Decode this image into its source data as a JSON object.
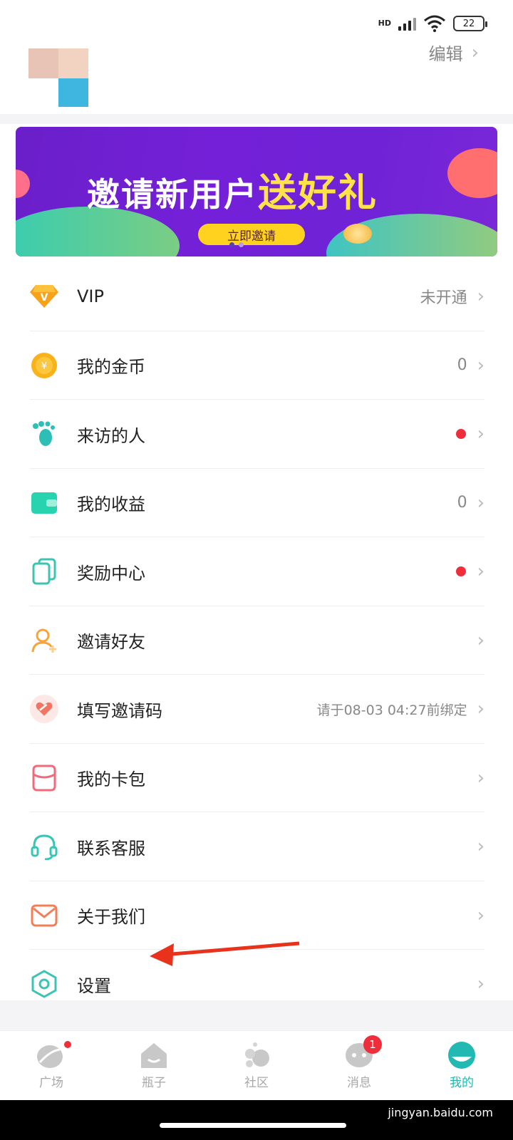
{
  "status_bar": {
    "network": "HD",
    "battery": "22"
  },
  "header": {
    "edit_label": "编辑"
  },
  "banner": {
    "title_main": "邀请新用户",
    "title_highlight": "送好礼",
    "cta_label": "立即邀请"
  },
  "menu": [
    {
      "label": "VIP",
      "value": "未开通",
      "icon": "vip-diamond-icon"
    },
    {
      "label": "我的金币",
      "value": "0",
      "icon": "gold-coin-icon"
    },
    {
      "label": "来访的人",
      "value": "",
      "dot": true,
      "icon": "footprint-icon"
    },
    {
      "label": "我的收益",
      "value": "0",
      "icon": "wallet-icon"
    },
    {
      "label": "奖励中心",
      "value": "",
      "dot": true,
      "icon": "reward-cards-icon"
    },
    {
      "label": "邀请好友",
      "value": "",
      "icon": "invite-friend-icon"
    },
    {
      "label": "填写邀请码",
      "value": "请于08-03 04:27前绑定",
      "icon": "heart-code-icon"
    },
    {
      "label": "我的卡包",
      "value": "",
      "icon": "card-wallet-icon"
    },
    {
      "label": "联系客服",
      "value": "",
      "icon": "headset-icon"
    },
    {
      "label": "关于我们",
      "value": "",
      "icon": "mail-icon"
    },
    {
      "label": "设置",
      "value": "",
      "icon": "settings-hexagon-icon"
    }
  ],
  "tabs": [
    {
      "label": "广场",
      "icon": "plaza-icon"
    },
    {
      "label": "瓶子",
      "icon": "bottle-house-icon"
    },
    {
      "label": "社区",
      "icon": "community-bubbles-icon"
    },
    {
      "label": "消息",
      "icon": "message-icon",
      "badge": "1"
    },
    {
      "label": "我的",
      "icon": "profile-face-icon",
      "active": true
    }
  ],
  "watermark": "jingyan.baidu.com"
}
